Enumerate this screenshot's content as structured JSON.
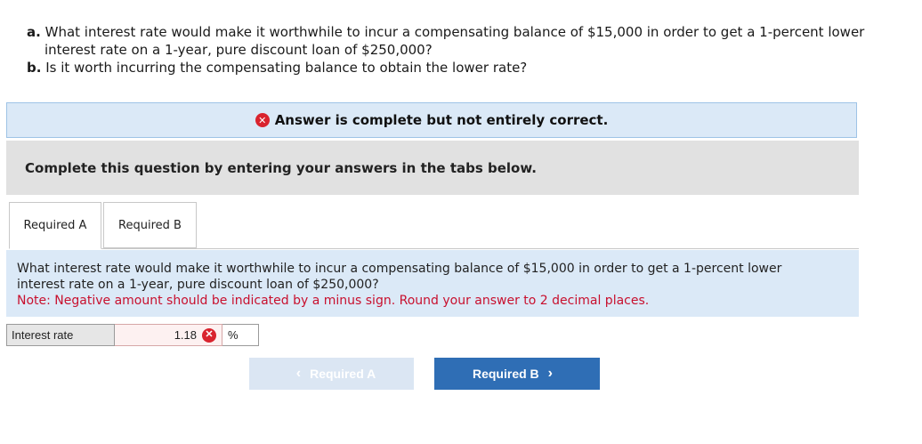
{
  "question": {
    "a_prefix": "a.",
    "a_line1": "What interest rate would make it worthwhile to incur a compensating balance of $15,000 in order to get a 1-percent lower",
    "a_line2": "interest rate on a 1-year, pure discount loan of $250,000?",
    "b_prefix": "b.",
    "b_line": "Is it worth incurring the compensating balance to obtain the lower rate?"
  },
  "banner": {
    "icon": "x-circle-icon",
    "text": "Answer is complete but not entirely correct.",
    "icon_color": "#d9232e"
  },
  "instructions": "Complete this question by entering your answers in the tabs below.",
  "tabs": [
    {
      "label": "Required A",
      "active": true
    },
    {
      "label": "Required B",
      "active": false
    }
  ],
  "panel": {
    "line1": "What interest rate would make it worthwhile to incur a compensating balance of $15,000 in order to get a 1-percent lower",
    "line2": "interest rate on a 1-year, pure discount loan of $250,000?",
    "note": "Note: Negative amount should be indicated by a minus sign. Round your answer to 2 decimal places."
  },
  "answer": {
    "label": "Interest rate",
    "value": "1.18",
    "unit": "%",
    "status": "incorrect"
  },
  "nav": {
    "prev_label": "Required A",
    "next_label": "Required B",
    "next_color": "#2f6eb5"
  }
}
